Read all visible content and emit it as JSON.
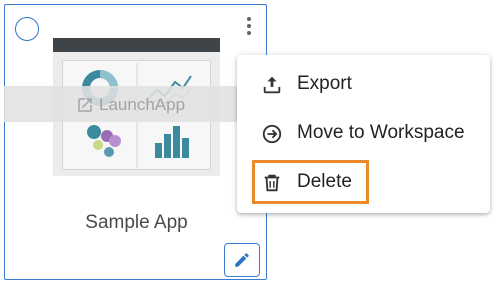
{
  "card": {
    "app_name": "Sample App",
    "launch_label": "LaunchApp",
    "select_state": "unchecked"
  },
  "menu": {
    "items": [
      {
        "label": "Export",
        "icon": "export-icon"
      },
      {
        "label": "Move to Workspace",
        "icon": "move-to-workspace-icon"
      },
      {
        "label": "Delete",
        "icon": "trash-icon"
      }
    ],
    "highlighted_item": "Delete"
  },
  "colors": {
    "accent": "#3b7ed0",
    "highlight": "#ec8a2b",
    "thumbnail_chart": "#3b8a9e"
  }
}
